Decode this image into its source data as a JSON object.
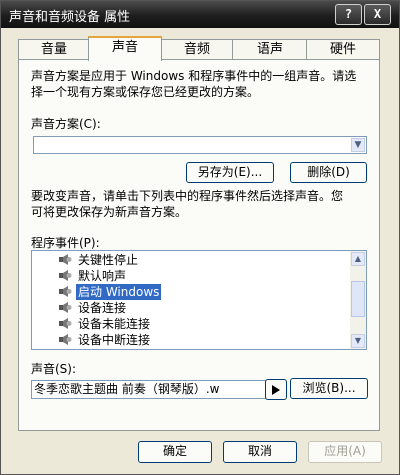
{
  "window": {
    "title": "声音和音频设备 属性",
    "help_label": "?",
    "close_label": "X"
  },
  "tabs": [
    {
      "label": "音量",
      "active": false
    },
    {
      "label": "声音",
      "active": true
    },
    {
      "label": "音频",
      "active": false
    },
    {
      "label": "语声",
      "active": false
    },
    {
      "label": "硬件",
      "active": false
    }
  ],
  "sound_tab": {
    "scheme_desc_line1": "声音方案是应用于 Windows 和程序事件中的一组声音。请选",
    "scheme_desc_line2": "择一个现有方案或保存您已经更改的方案。",
    "scheme_label": "声音方案(C):",
    "scheme_value": "",
    "save_as_label": "另存为(E)...",
    "delete_label": "删除(D)",
    "change_desc_line1": "要改变声音，请单击下列表中的程序事件然后选择声音。您",
    "change_desc_line2": "可将更改保存为新声音方案。",
    "events_label": "程序事件(P):",
    "events": [
      {
        "label": "关键性停止",
        "selected": false
      },
      {
        "label": "默认响声",
        "selected": false
      },
      {
        "label": "启动 Windows",
        "selected": true
      },
      {
        "label": "设备连接",
        "selected": false
      },
      {
        "label": "设备未能连接",
        "selected": false
      },
      {
        "label": "设备中断连接",
        "selected": false
      }
    ],
    "sound_label": "声音(S):",
    "sound_value": "冬季恋歌主题曲 前奏（钢琴版）.w",
    "play_icon": "play-triangle",
    "browse_label": "浏览(B)..."
  },
  "footer": {
    "ok_label": "确定",
    "cancel_label": "取消",
    "apply_label": "应用(A)"
  }
}
